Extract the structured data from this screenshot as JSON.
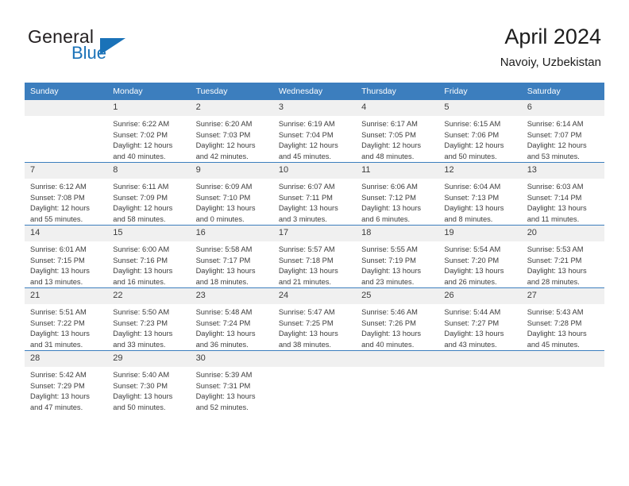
{
  "brand": {
    "name_part1": "General",
    "name_part2": "Blue"
  },
  "header": {
    "title": "April 2024",
    "subtitle": "Navoiy, Uzbekistan"
  },
  "colors": {
    "header_blue": "#3c7ebe",
    "brand_blue": "#1a72b8",
    "daynum_band": "#f0f0f0",
    "text": "#3c3c3c"
  },
  "weekdays": [
    "Sunday",
    "Monday",
    "Tuesday",
    "Wednesday",
    "Thursday",
    "Friday",
    "Saturday"
  ],
  "weeks": [
    [
      {
        "day": "",
        "sunrise": "",
        "sunset": "",
        "daylight_line1": "",
        "daylight_line2": ""
      },
      {
        "day": "1",
        "sunrise": "Sunrise: 6:22 AM",
        "sunset": "Sunset: 7:02 PM",
        "daylight_line1": "Daylight: 12 hours",
        "daylight_line2": "and 40 minutes."
      },
      {
        "day": "2",
        "sunrise": "Sunrise: 6:20 AM",
        "sunset": "Sunset: 7:03 PM",
        "daylight_line1": "Daylight: 12 hours",
        "daylight_line2": "and 42 minutes."
      },
      {
        "day": "3",
        "sunrise": "Sunrise: 6:19 AM",
        "sunset": "Sunset: 7:04 PM",
        "daylight_line1": "Daylight: 12 hours",
        "daylight_line2": "and 45 minutes."
      },
      {
        "day": "4",
        "sunrise": "Sunrise: 6:17 AM",
        "sunset": "Sunset: 7:05 PM",
        "daylight_line1": "Daylight: 12 hours",
        "daylight_line2": "and 48 minutes."
      },
      {
        "day": "5",
        "sunrise": "Sunrise: 6:15 AM",
        "sunset": "Sunset: 7:06 PM",
        "daylight_line1": "Daylight: 12 hours",
        "daylight_line2": "and 50 minutes."
      },
      {
        "day": "6",
        "sunrise": "Sunrise: 6:14 AM",
        "sunset": "Sunset: 7:07 PM",
        "daylight_line1": "Daylight: 12 hours",
        "daylight_line2": "and 53 minutes."
      }
    ],
    [
      {
        "day": "7",
        "sunrise": "Sunrise: 6:12 AM",
        "sunset": "Sunset: 7:08 PM",
        "daylight_line1": "Daylight: 12 hours",
        "daylight_line2": "and 55 minutes."
      },
      {
        "day": "8",
        "sunrise": "Sunrise: 6:11 AM",
        "sunset": "Sunset: 7:09 PM",
        "daylight_line1": "Daylight: 12 hours",
        "daylight_line2": "and 58 minutes."
      },
      {
        "day": "9",
        "sunrise": "Sunrise: 6:09 AM",
        "sunset": "Sunset: 7:10 PM",
        "daylight_line1": "Daylight: 13 hours",
        "daylight_line2": "and 0 minutes."
      },
      {
        "day": "10",
        "sunrise": "Sunrise: 6:07 AM",
        "sunset": "Sunset: 7:11 PM",
        "daylight_line1": "Daylight: 13 hours",
        "daylight_line2": "and 3 minutes."
      },
      {
        "day": "11",
        "sunrise": "Sunrise: 6:06 AM",
        "sunset": "Sunset: 7:12 PM",
        "daylight_line1": "Daylight: 13 hours",
        "daylight_line2": "and 6 minutes."
      },
      {
        "day": "12",
        "sunrise": "Sunrise: 6:04 AM",
        "sunset": "Sunset: 7:13 PM",
        "daylight_line1": "Daylight: 13 hours",
        "daylight_line2": "and 8 minutes."
      },
      {
        "day": "13",
        "sunrise": "Sunrise: 6:03 AM",
        "sunset": "Sunset: 7:14 PM",
        "daylight_line1": "Daylight: 13 hours",
        "daylight_line2": "and 11 minutes."
      }
    ],
    [
      {
        "day": "14",
        "sunrise": "Sunrise: 6:01 AM",
        "sunset": "Sunset: 7:15 PM",
        "daylight_line1": "Daylight: 13 hours",
        "daylight_line2": "and 13 minutes."
      },
      {
        "day": "15",
        "sunrise": "Sunrise: 6:00 AM",
        "sunset": "Sunset: 7:16 PM",
        "daylight_line1": "Daylight: 13 hours",
        "daylight_line2": "and 16 minutes."
      },
      {
        "day": "16",
        "sunrise": "Sunrise: 5:58 AM",
        "sunset": "Sunset: 7:17 PM",
        "daylight_line1": "Daylight: 13 hours",
        "daylight_line2": "and 18 minutes."
      },
      {
        "day": "17",
        "sunrise": "Sunrise: 5:57 AM",
        "sunset": "Sunset: 7:18 PM",
        "daylight_line1": "Daylight: 13 hours",
        "daylight_line2": "and 21 minutes."
      },
      {
        "day": "18",
        "sunrise": "Sunrise: 5:55 AM",
        "sunset": "Sunset: 7:19 PM",
        "daylight_line1": "Daylight: 13 hours",
        "daylight_line2": "and 23 minutes."
      },
      {
        "day": "19",
        "sunrise": "Sunrise: 5:54 AM",
        "sunset": "Sunset: 7:20 PM",
        "daylight_line1": "Daylight: 13 hours",
        "daylight_line2": "and 26 minutes."
      },
      {
        "day": "20",
        "sunrise": "Sunrise: 5:53 AM",
        "sunset": "Sunset: 7:21 PM",
        "daylight_line1": "Daylight: 13 hours",
        "daylight_line2": "and 28 minutes."
      }
    ],
    [
      {
        "day": "21",
        "sunrise": "Sunrise: 5:51 AM",
        "sunset": "Sunset: 7:22 PM",
        "daylight_line1": "Daylight: 13 hours",
        "daylight_line2": "and 31 minutes."
      },
      {
        "day": "22",
        "sunrise": "Sunrise: 5:50 AM",
        "sunset": "Sunset: 7:23 PM",
        "daylight_line1": "Daylight: 13 hours",
        "daylight_line2": "and 33 minutes."
      },
      {
        "day": "23",
        "sunrise": "Sunrise: 5:48 AM",
        "sunset": "Sunset: 7:24 PM",
        "daylight_line1": "Daylight: 13 hours",
        "daylight_line2": "and 36 minutes."
      },
      {
        "day": "24",
        "sunrise": "Sunrise: 5:47 AM",
        "sunset": "Sunset: 7:25 PM",
        "daylight_line1": "Daylight: 13 hours",
        "daylight_line2": "and 38 minutes."
      },
      {
        "day": "25",
        "sunrise": "Sunrise: 5:46 AM",
        "sunset": "Sunset: 7:26 PM",
        "daylight_line1": "Daylight: 13 hours",
        "daylight_line2": "and 40 minutes."
      },
      {
        "day": "26",
        "sunrise": "Sunrise: 5:44 AM",
        "sunset": "Sunset: 7:27 PM",
        "daylight_line1": "Daylight: 13 hours",
        "daylight_line2": "and 43 minutes."
      },
      {
        "day": "27",
        "sunrise": "Sunrise: 5:43 AM",
        "sunset": "Sunset: 7:28 PM",
        "daylight_line1": "Daylight: 13 hours",
        "daylight_line2": "and 45 minutes."
      }
    ],
    [
      {
        "day": "28",
        "sunrise": "Sunrise: 5:42 AM",
        "sunset": "Sunset: 7:29 PM",
        "daylight_line1": "Daylight: 13 hours",
        "daylight_line2": "and 47 minutes."
      },
      {
        "day": "29",
        "sunrise": "Sunrise: 5:40 AM",
        "sunset": "Sunset: 7:30 PM",
        "daylight_line1": "Daylight: 13 hours",
        "daylight_line2": "and 50 minutes."
      },
      {
        "day": "30",
        "sunrise": "Sunrise: 5:39 AM",
        "sunset": "Sunset: 7:31 PM",
        "daylight_line1": "Daylight: 13 hours",
        "daylight_line2": "and 52 minutes."
      },
      {
        "day": "",
        "sunrise": "",
        "sunset": "",
        "daylight_line1": "",
        "daylight_line2": ""
      },
      {
        "day": "",
        "sunrise": "",
        "sunset": "",
        "daylight_line1": "",
        "daylight_line2": ""
      },
      {
        "day": "",
        "sunrise": "",
        "sunset": "",
        "daylight_line1": "",
        "daylight_line2": ""
      },
      {
        "day": "",
        "sunrise": "",
        "sunset": "",
        "daylight_line1": "",
        "daylight_line2": ""
      }
    ]
  ]
}
